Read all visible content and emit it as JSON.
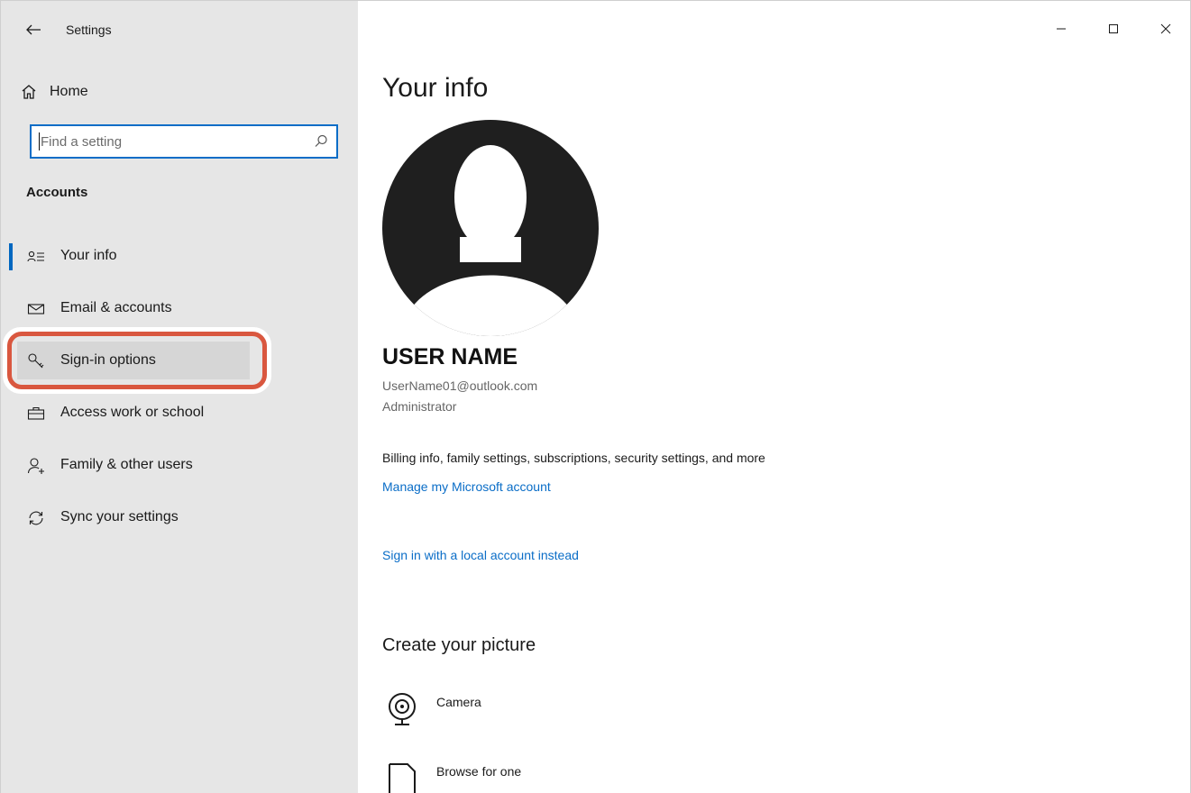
{
  "window": {
    "app_title": "Settings",
    "controls": [
      "minimize-icon",
      "maximize-icon",
      "close-icon"
    ]
  },
  "sidebar": {
    "home_label": "Home",
    "search": {
      "placeholder": "Find a setting",
      "value": ""
    },
    "section_heading": "Accounts",
    "items": [
      {
        "label": "Your info",
        "icon": "your-info-icon",
        "selected": true
      },
      {
        "label": "Email & accounts",
        "icon": "mail-icon",
        "selected": false
      },
      {
        "label": "Sign-in options",
        "icon": "key-icon",
        "selected": false,
        "highlighted": true
      },
      {
        "label": "Access work or school",
        "icon": "briefcase-icon",
        "selected": false
      },
      {
        "label": "Family & other users",
        "icon": "add-person-icon",
        "selected": false
      },
      {
        "label": "Sync your settings",
        "icon": "sync-icon",
        "selected": false
      }
    ]
  },
  "main": {
    "title": "Your info",
    "user": {
      "name": "USER NAME",
      "email": "UserName01@outlook.com",
      "role": "Administrator"
    },
    "billing_text": "Billing info, family settings, subscriptions, security settings, and more",
    "manage_link": "Manage my Microsoft account",
    "local_link": "Sign in with a local account instead",
    "create_heading": "Create your picture",
    "options": [
      {
        "label": "Camera",
        "icon": "camera-icon"
      },
      {
        "label": "Browse for one",
        "icon": "browse-icon"
      }
    ]
  },
  "colors": {
    "sidebar_bg": "#e6e6e6",
    "accent": "#0067c0",
    "link": "#0a6dc7",
    "highlight_ring": "#d9573f"
  }
}
